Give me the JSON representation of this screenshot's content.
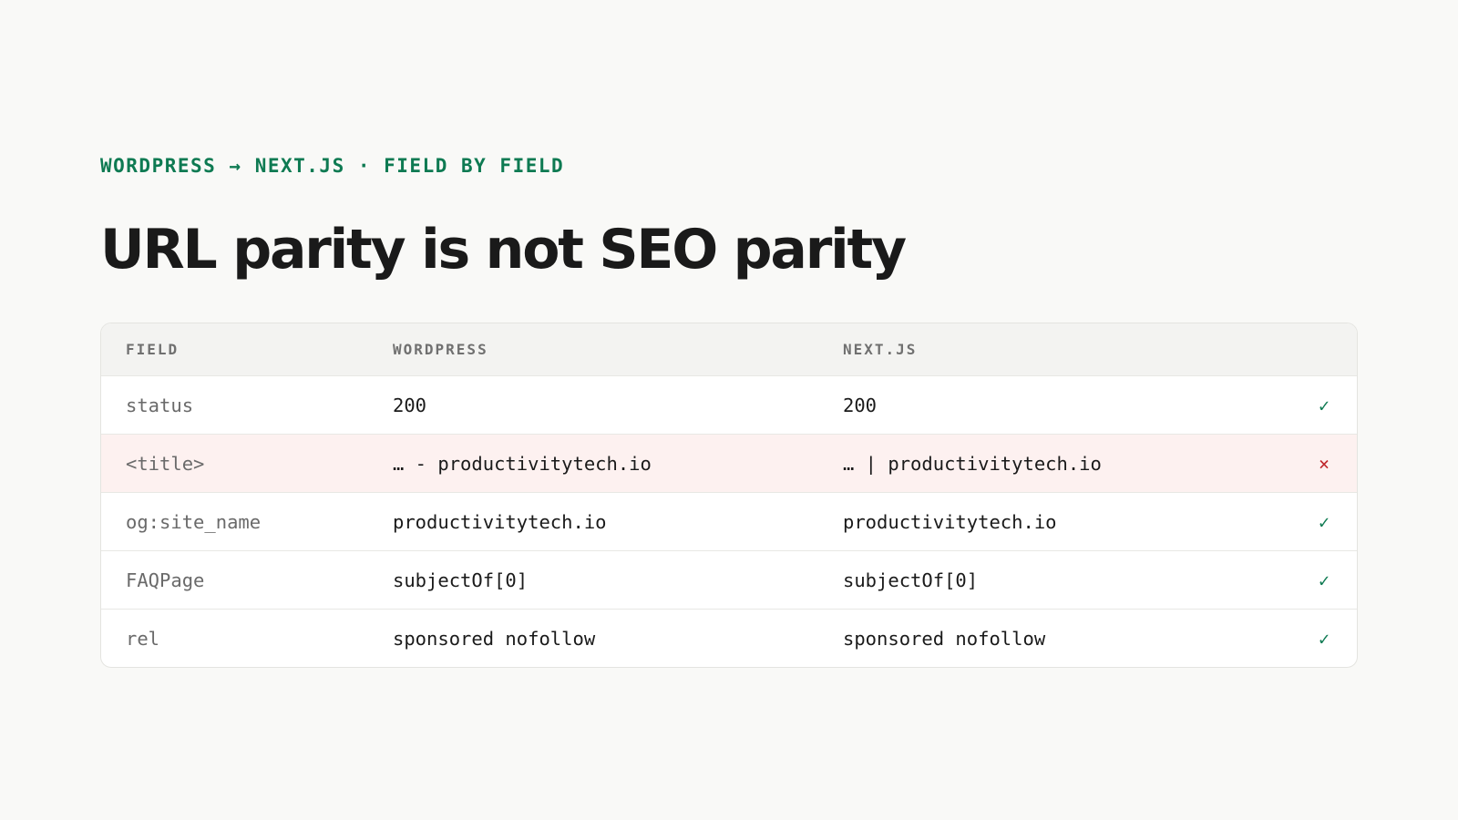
{
  "eyebrow": "WORDPRESS → NEXT.JS · FIELD BY FIELD",
  "title": "URL parity is not SEO parity",
  "table": {
    "headers": {
      "field": "FIELD",
      "wordpress": "WORDPRESS",
      "nextjs": "NEXT.JS"
    },
    "rows": [
      {
        "field": "status",
        "wordpress": "200",
        "nextjs": "200",
        "match": true,
        "mark": "✓"
      },
      {
        "field": "<title>",
        "wordpress": "… - productivitytech.io",
        "nextjs": "… | productivitytech.io",
        "match": false,
        "mark": "×"
      },
      {
        "field": "og:site_name",
        "wordpress": "productivitytech.io",
        "nextjs": "productivitytech.io",
        "match": true,
        "mark": "✓"
      },
      {
        "field": "FAQPage",
        "wordpress": "subjectOf[0]",
        "nextjs": "subjectOf[0]",
        "match": true,
        "mark": "✓"
      },
      {
        "field": "rel",
        "wordpress": "sponsored nofollow",
        "nextjs": "sponsored nofollow",
        "match": true,
        "mark": "✓"
      }
    ]
  },
  "colors": {
    "accent": "#0e7a52",
    "mismatch_bg": "#fdf1f0",
    "mismatch_mark": "#c0282d",
    "background": "#f9f9f7"
  },
  "icons": {
    "match": "check-icon",
    "mismatch": "cross-icon"
  }
}
